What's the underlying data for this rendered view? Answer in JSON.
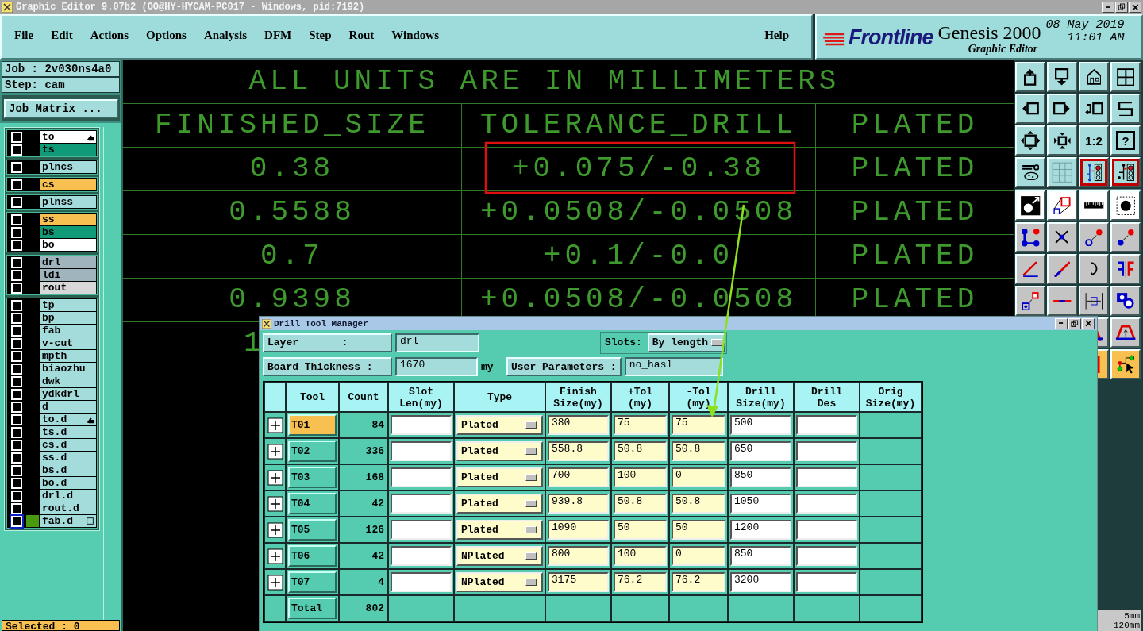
{
  "window": {
    "title": "Graphic Editor 9.07b2 (OO@HY-HYCAM-PC017 - Windows, pid:7192)"
  },
  "menu": [
    {
      "label": "File",
      "mnemonic": true
    },
    {
      "label": "Edit",
      "mnemonic": true
    },
    {
      "label": "Actions",
      "mnemonic": true
    },
    {
      "label": "Options",
      "mnemonic": false
    },
    {
      "label": "Analysis",
      "mnemonic": false
    },
    {
      "label": "DFM",
      "mnemonic": false
    },
    {
      "label": "Step",
      "mnemonic": true
    },
    {
      "label": "Rout",
      "mnemonic": true
    },
    {
      "label": "Windows",
      "mnemonic": true
    }
  ],
  "help": "Help",
  "brand": {
    "logo": "Frontline",
    "product": "Genesis 2000",
    "module": "Graphic Editor",
    "date": "08 May 2019",
    "time": "11:01 AM"
  },
  "job_panel": {
    "job": "Job : 2v030ns4a0",
    "step": "Step: cam",
    "matrix_button": "Job Matrix ..."
  },
  "layer_groups": [
    [
      {
        "name": "to",
        "color": "#ffffff",
        "checked": false,
        "affected": false,
        "marker": {
          "kind": "hand"
        }
      },
      {
        "name": "ts",
        "color": "#109a78",
        "checked": false,
        "affected": false
      }
    ],
    [
      {
        "name": "plncs",
        "color": "#a4dcdc",
        "checked": false,
        "affected": false
      }
    ],
    [
      {
        "name": "cs",
        "color": "#f8c050",
        "checked": false,
        "affected": false
      }
    ],
    [
      {
        "name": "plnss",
        "color": "#a4dcdc",
        "checked": false,
        "affected": false
      }
    ],
    [
      {
        "name": "ss",
        "color": "#f8c050",
        "checked": false,
        "affected": false
      },
      {
        "name": "bs",
        "color": "#109a78",
        "checked": false,
        "affected": false
      },
      {
        "name": "bo",
        "color": "#ffffff",
        "checked": false,
        "affected": false
      }
    ],
    [
      {
        "name": "drl",
        "color": "#9fb4bc",
        "checked": false,
        "affected": false
      },
      {
        "name": "ldi",
        "color": "#9fb4bc",
        "checked": false,
        "affected": false
      },
      {
        "name": "rout",
        "color": "#d8d8d8",
        "checked": false,
        "affected": false
      }
    ],
    [
      {
        "name": "tp",
        "color": "#a4dcdc",
        "checked": false,
        "affected": false
      },
      {
        "name": "bp",
        "color": "#a4dcdc",
        "checked": false,
        "affected": false
      },
      {
        "name": "fab",
        "color": "#a4dcdc",
        "checked": false,
        "affected": false
      },
      {
        "name": "v-cut",
        "color": "#a4dcdc",
        "checked": false,
        "affected": false
      },
      {
        "name": "mpth",
        "color": "#a4dcdc",
        "checked": false,
        "affected": false
      },
      {
        "name": "biaozhu",
        "color": "#a4dcdc",
        "checked": false,
        "affected": false
      },
      {
        "name": "dwk",
        "color": "#a4dcdc",
        "checked": false,
        "affected": false
      },
      {
        "name": "ydkdrl",
        "color": "#a4dcdc",
        "checked": false,
        "affected": false
      },
      {
        "name": "d",
        "color": "#a4dcdc",
        "checked": false,
        "affected": false
      },
      {
        "name": "to.d",
        "color": "#a4dcdc",
        "checked": false,
        "affected": false,
        "marker": {
          "kind": "hand"
        }
      },
      {
        "name": "ts.d",
        "color": "#a4dcdc",
        "checked": false,
        "affected": false
      },
      {
        "name": "cs.d",
        "color": "#a4dcdc",
        "checked": false,
        "affected": false
      },
      {
        "name": "ss.d",
        "color": "#a4dcdc",
        "checked": false,
        "affected": false
      },
      {
        "name": "bs.d",
        "color": "#a4dcdc",
        "checked": false,
        "affected": false
      },
      {
        "name": "bo.d",
        "color": "#a4dcdc",
        "checked": false,
        "affected": false
      },
      {
        "name": "drl.d",
        "color": "#a4dcdc",
        "checked": false,
        "affected": false
      },
      {
        "name": "rout.d",
        "color": "#a4dcdc",
        "checked": false,
        "affected": false
      },
      {
        "name": "fab.d",
        "color": "#a4dcdc",
        "checked": false,
        "affected": true,
        "marker": {
          "kind": "grid"
        }
      }
    ]
  ],
  "status": "Selected : 0",
  "canvas": {
    "banner": "ALL UNITS ARE IN MILLIMETERS",
    "rows": [
      {
        "kind": "full",
        "cells": [
          "FINISHED_SIZE",
          "TOLERANCE_DRILL",
          "PLATED"
        ]
      },
      {
        "kind": "full",
        "cells": [
          "0.38",
          "+0.075/-0.38",
          "PLATED"
        ]
      },
      {
        "kind": "full",
        "cells": [
          "0.5588",
          "+0.0508/-0.0508",
          "PLATED"
        ]
      },
      {
        "kind": "full",
        "cells": [
          "0.7",
          "+0.1/-0.0",
          "PLATED"
        ]
      },
      {
        "kind": "full",
        "cells": [
          "0.9398",
          "+0.0508/-0.0508",
          "PLATED"
        ]
      },
      {
        "kind": "cut",
        "cells": [
          "1"
        ]
      }
    ]
  },
  "toolbar": {
    "view_tools": [
      {
        "kind": "up",
        "active": false
      },
      {
        "kind": "down",
        "active": false
      },
      {
        "kind": "house",
        "active": false
      },
      {
        "kind": "panes",
        "active": false
      },
      {
        "kind": "left",
        "active": false
      },
      {
        "kind": "right",
        "active": false
      },
      {
        "kind": "undo",
        "active": false
      },
      {
        "kind": "scurve",
        "active": false
      },
      {
        "kind": "expand",
        "active": false
      },
      {
        "kind": "shrink",
        "active": false
      },
      {
        "kind": "label",
        "label": "1:2",
        "active": false
      },
      {
        "kind": "framed-label",
        "label": "?",
        "active": false
      },
      {
        "kind": "tools",
        "active": false
      },
      {
        "kind": "grid",
        "active": false
      },
      {
        "kind": "pcb",
        "active": true
      },
      {
        "kind": "pcb2",
        "active": true
      }
    ],
    "edit_tools": [
      {
        "kind": "snapshot",
        "active": false
      },
      {
        "kind": "shapes",
        "active": false
      },
      {
        "kind": "ruler",
        "active": false
      },
      {
        "kind": "dotframe",
        "active": false
      },
      {
        "kind": "nodes",
        "active": false
      },
      {
        "kind": "cross",
        "active": false
      },
      {
        "kind": "ringarrow",
        "active": false
      },
      {
        "kind": "dotarrow",
        "active": false
      },
      {
        "kind": "angle",
        "active": false
      },
      {
        "kind": "diagonal",
        "active": false
      },
      {
        "kind": "rotate",
        "active": false
      },
      {
        "kind": "mirror",
        "active": false
      },
      {
        "kind": "squares",
        "active": false
      },
      {
        "kind": "redblue",
        "active": false
      },
      {
        "kind": "measure",
        "active": false
      },
      {
        "kind": "blob",
        "active": false
      },
      {
        "kind": "peak",
        "active": false
      },
      {
        "kind": "trapezoid",
        "active": false
      },
      {
        "kind": "frame",
        "active": true
      },
      {
        "kind": "route",
        "active": true
      }
    ]
  },
  "scale_readouts": [
    "5mm",
    "120mm"
  ],
  "dialog": {
    "title": "Drill Tool Manager",
    "layer_label": "Layer       :",
    "layer": "drl",
    "slots_label": "Slots:",
    "slots": "By length",
    "thickness_label": "Board Thickness :",
    "thickness": "1670",
    "thickness_unit": "my",
    "user_params": "User Parameters :",
    "user_param_value": "no_hasl",
    "columns": [
      "Tool",
      "Count",
      "Slot\nLen(my)",
      "Type",
      "Finish\nSize(my)",
      "+Tol\n(my)",
      "-Tol\n(my)",
      "Drill\nSize(my)",
      "Drill\nDes",
      "Orig\nSize(my)"
    ],
    "rows": [
      {
        "tool": "T01",
        "count": "84",
        "type": "Plated",
        "finish": "380",
        "plus_tol": "75",
        "minus_tol": "75",
        "drill": "500",
        "selected": true
      },
      {
        "tool": "T02",
        "count": "336",
        "type": "Plated",
        "finish": "558.8",
        "plus_tol": "50.8",
        "minus_tol": "50.8",
        "drill": "650",
        "selected": false
      },
      {
        "tool": "T03",
        "count": "168",
        "type": "Plated",
        "finish": "700",
        "plus_tol": "100",
        "minus_tol": "0",
        "drill": "850",
        "selected": false
      },
      {
        "tool": "T04",
        "count": "42",
        "type": "Plated",
        "finish": "939.8",
        "plus_tol": "50.8",
        "minus_tol": "50.8",
        "drill": "1050",
        "selected": false
      },
      {
        "tool": "T05",
        "count": "126",
        "type": "Plated",
        "finish": "1090",
        "plus_tol": "50",
        "minus_tol": "50",
        "drill": "1200",
        "selected": false
      },
      {
        "tool": "T06",
        "count": "42",
        "type": "NPlated",
        "finish": "800",
        "plus_tol": "100",
        "minus_tol": "0",
        "drill": "850",
        "selected": false
      },
      {
        "tool": "T07",
        "count": "4",
        "type": "NPlated",
        "finish": "3175",
        "plus_tol": "76.2",
        "minus_tol": "76.2",
        "drill": "3200",
        "selected": false
      }
    ],
    "total": {
      "label": "Total",
      "count": "802"
    }
  }
}
